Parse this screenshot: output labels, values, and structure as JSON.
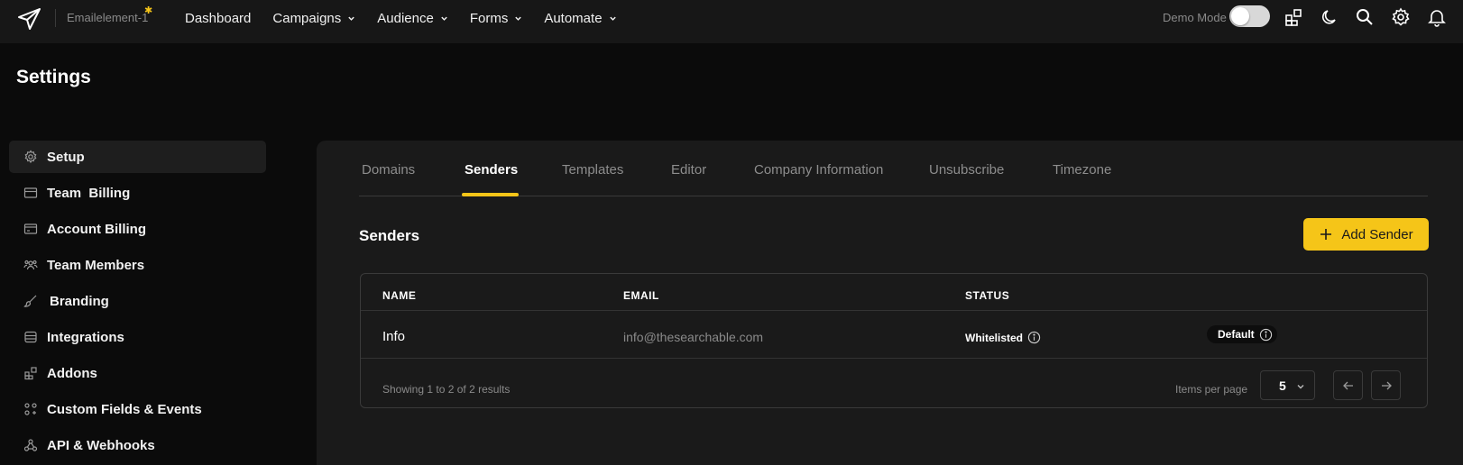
{
  "topbar": {
    "brand": "Emailelement-1",
    "nav": [
      {
        "label": "Dashboard",
        "dropdown": false
      },
      {
        "label": "Campaigns",
        "dropdown": true
      },
      {
        "label": "Audience",
        "dropdown": true
      },
      {
        "label": "Forms",
        "dropdown": true
      },
      {
        "label": "Automate",
        "dropdown": true
      }
    ],
    "demo_mode_label": "Demo Mode",
    "demo_mode_on": false,
    "icons": [
      "apps-icon",
      "moon-icon",
      "search-icon",
      "gear-icon",
      "bell-icon"
    ]
  },
  "page": {
    "title": "Settings"
  },
  "sidebar": {
    "items": [
      {
        "label": "Setup",
        "icon": "gear-icon",
        "active": true
      },
      {
        "label": "Team  Billing",
        "icon": "card-icon",
        "active": false
      },
      {
        "label": "Account Billing",
        "icon": "wallet-icon",
        "active": false
      },
      {
        "label": "Team Members",
        "icon": "users-icon",
        "active": false
      },
      {
        "label": "Branding",
        "icon": "brush-icon",
        "active": false
      },
      {
        "label": "Integrations",
        "icon": "database-icon",
        "active": false
      },
      {
        "label": "Addons",
        "icon": "grid-icon",
        "active": false
      },
      {
        "label": "Custom Fields & Events",
        "icon": "shapes-icon",
        "active": false
      },
      {
        "label": "API & Webhooks",
        "icon": "webhook-icon",
        "active": false
      }
    ]
  },
  "tabs": [
    {
      "label": "Domains",
      "active": false
    },
    {
      "label": "Senders",
      "active": true
    },
    {
      "label": "Templates",
      "active": false
    },
    {
      "label": "Editor",
      "active": false
    },
    {
      "label": "Company Information",
      "active": false
    },
    {
      "label": "Unsubscribe",
      "active": false
    },
    {
      "label": "Timezone",
      "active": false
    }
  ],
  "senders": {
    "title": "Senders",
    "add_button": "Add Sender",
    "columns": [
      "NAME",
      "EMAIL",
      "STATUS"
    ],
    "rows": [
      {
        "name": "Info",
        "email": "info@thesearchable.com",
        "status": "Whitelisted",
        "badge": "Default"
      }
    ],
    "footer": "Showing 1 to 2 of 2 results",
    "items_per_page_label": "Items per page",
    "items_per_page": "5"
  },
  "colors": {
    "accent": "#f5c518",
    "background": "#0b0b0b",
    "panel": "#1a1a1a"
  }
}
